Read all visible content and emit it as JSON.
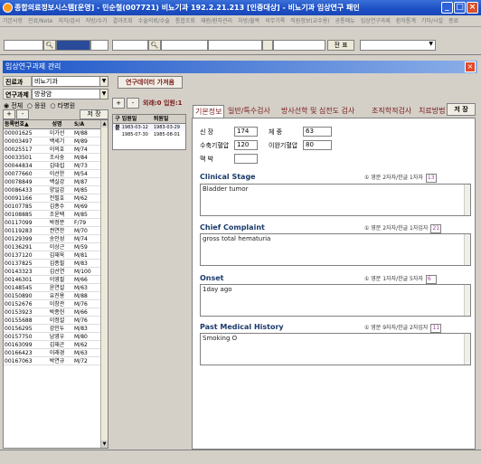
{
  "window": {
    "title": "종합의료정보시스템[운영] - 민순철(007721) 비뇨기과  192.2.21.213  [인증대상] - 비뇨기과 임상연구 패인"
  },
  "menu": [
    "기본사항",
    "진료/Note",
    "처치/검사",
    "처방/수가",
    "결과조회",
    "수술의뢰/수술",
    "통합조회",
    "재원/환자관리",
    "처방/물목",
    "의무기록",
    "직원정보(교수용)",
    "공통메뉴",
    "임상연구과제",
    "환자통계",
    "기타/시설",
    "종료"
  ],
  "toolbar": {
    "btn_label": "전 표"
  },
  "subwindow": {
    "title": "임상연구과제 관리"
  },
  "left": {
    "dept_label": "진료과",
    "dept_value": "비뇨기과",
    "project_label": "연구과제",
    "project_value": "방광암",
    "radio_all": "전체",
    "radio_inpatient": "응원",
    "radio_outpatient": "타병원",
    "add": "+",
    "remove": "-",
    "save": "저 장",
    "col_id": "등록번호▲",
    "col_name": "성명",
    "col_sa": "S/A"
  },
  "patients": [
    {
      "id": "00001625",
      "name": "이가선",
      "sa": "M/88"
    },
    {
      "id": "00003497",
      "name": "백세기",
      "sa": "M/89"
    },
    {
      "id": "00025517",
      "name": "이의호",
      "sa": "M/74"
    },
    {
      "id": "00033501",
      "name": "조사숭",
      "sa": "M/84"
    },
    {
      "id": "00044834",
      "name": "김대섭",
      "sa": "M/73"
    },
    {
      "id": "00077660",
      "name": "이선한",
      "sa": "M/54"
    },
    {
      "id": "00078849",
      "name": "백실강",
      "sa": "M/87"
    },
    {
      "id": "00086433",
      "name": "양일감",
      "sa": "M/85"
    },
    {
      "id": "00091166",
      "name": "전필호",
      "sa": "M/62"
    },
    {
      "id": "00107785",
      "name": "김종수",
      "sa": "M/69"
    },
    {
      "id": "00108885",
      "name": "조윤택",
      "sa": "M/85"
    },
    {
      "id": "00117099",
      "name": "박정분",
      "sa": "F/79"
    },
    {
      "id": "00119283",
      "name": "권연한",
      "sa": "M/70"
    },
    {
      "id": "00129399",
      "name": "송인성",
      "sa": "M/74"
    },
    {
      "id": "00136291",
      "name": "이상근",
      "sa": "M/59"
    },
    {
      "id": "00137120",
      "name": "김재욱",
      "sa": "M/81"
    },
    {
      "id": "00137825",
      "name": "김종필",
      "sa": "M/83"
    },
    {
      "id": "00143323",
      "name": "김선연",
      "sa": "M/100"
    },
    {
      "id": "00146301",
      "name": "이영필",
      "sa": "M/66"
    },
    {
      "id": "00148545",
      "name": "윤연설",
      "sa": "M/63"
    },
    {
      "id": "00150890",
      "name": "유진용",
      "sa": "M/88"
    },
    {
      "id": "00152676",
      "name": "이창관",
      "sa": "M/76"
    },
    {
      "id": "00153923",
      "name": "박종헌",
      "sa": "M/66"
    },
    {
      "id": "00155688",
      "name": "이정설",
      "sa": "M/76"
    },
    {
      "id": "00156295",
      "name": "강인두",
      "sa": "M/83"
    },
    {
      "id": "00157750",
      "name": "남영우",
      "sa": "M/80"
    },
    {
      "id": "00163099",
      "name": "김재곤",
      "sa": "M/62"
    },
    {
      "id": "00166423",
      "name": "이래경",
      "sa": "M/63"
    },
    {
      "id": "00167063",
      "name": "박연규",
      "sa": "M/72"
    }
  ],
  "middle": {
    "header_btn": "연구데이터 가져옴",
    "add": "+",
    "remove": "-",
    "counts": "외래:0 입원:1",
    "col_gubun": "구분",
    "col_admit": "입원일",
    "col_discharge": "퇴원일",
    "rows": [
      {
        "g": "입",
        "a": "1983-03-12",
        "d": "1983-03-29"
      },
      {
        "g": "",
        "a": "1985-07-30",
        "d": "1985-08-01"
      }
    ]
  },
  "tabs": [
    "기본정보",
    "일반/특수검사",
    "방사선학 및 심전도 검사",
    "조직학적검사",
    "치료방법"
  ],
  "save_button": "저 장",
  "basic": {
    "height_label": "신 장",
    "height_value": "174",
    "weight_label": "체 중",
    "weight_value": "63",
    "sbp_label": "수축기혈압",
    "sbp_value": "120",
    "dbp_label": "이완기혈압",
    "dbp_value": "80",
    "pulse_label": "맥 박",
    "pulse_value": ""
  },
  "sections": [
    {
      "title": "Clinical Stage",
      "hint": "① 영문 2자자/한글 1자자",
      "count": "13",
      "text": "Bladder tumor"
    },
    {
      "title": "Chief Complaint",
      "hint": "① 영문 2자자/한글 1자입자",
      "count": "21",
      "text": "gross total hematuria"
    },
    {
      "title": "Onset",
      "hint": "① 영문 1자자/한글 5자자",
      "count": "6",
      "text": "1day ago"
    },
    {
      "title": "Past Medical History",
      "hint": "① 영문 9자자/한글 2자입자",
      "count": "11",
      "text": "Smoking O"
    }
  ]
}
